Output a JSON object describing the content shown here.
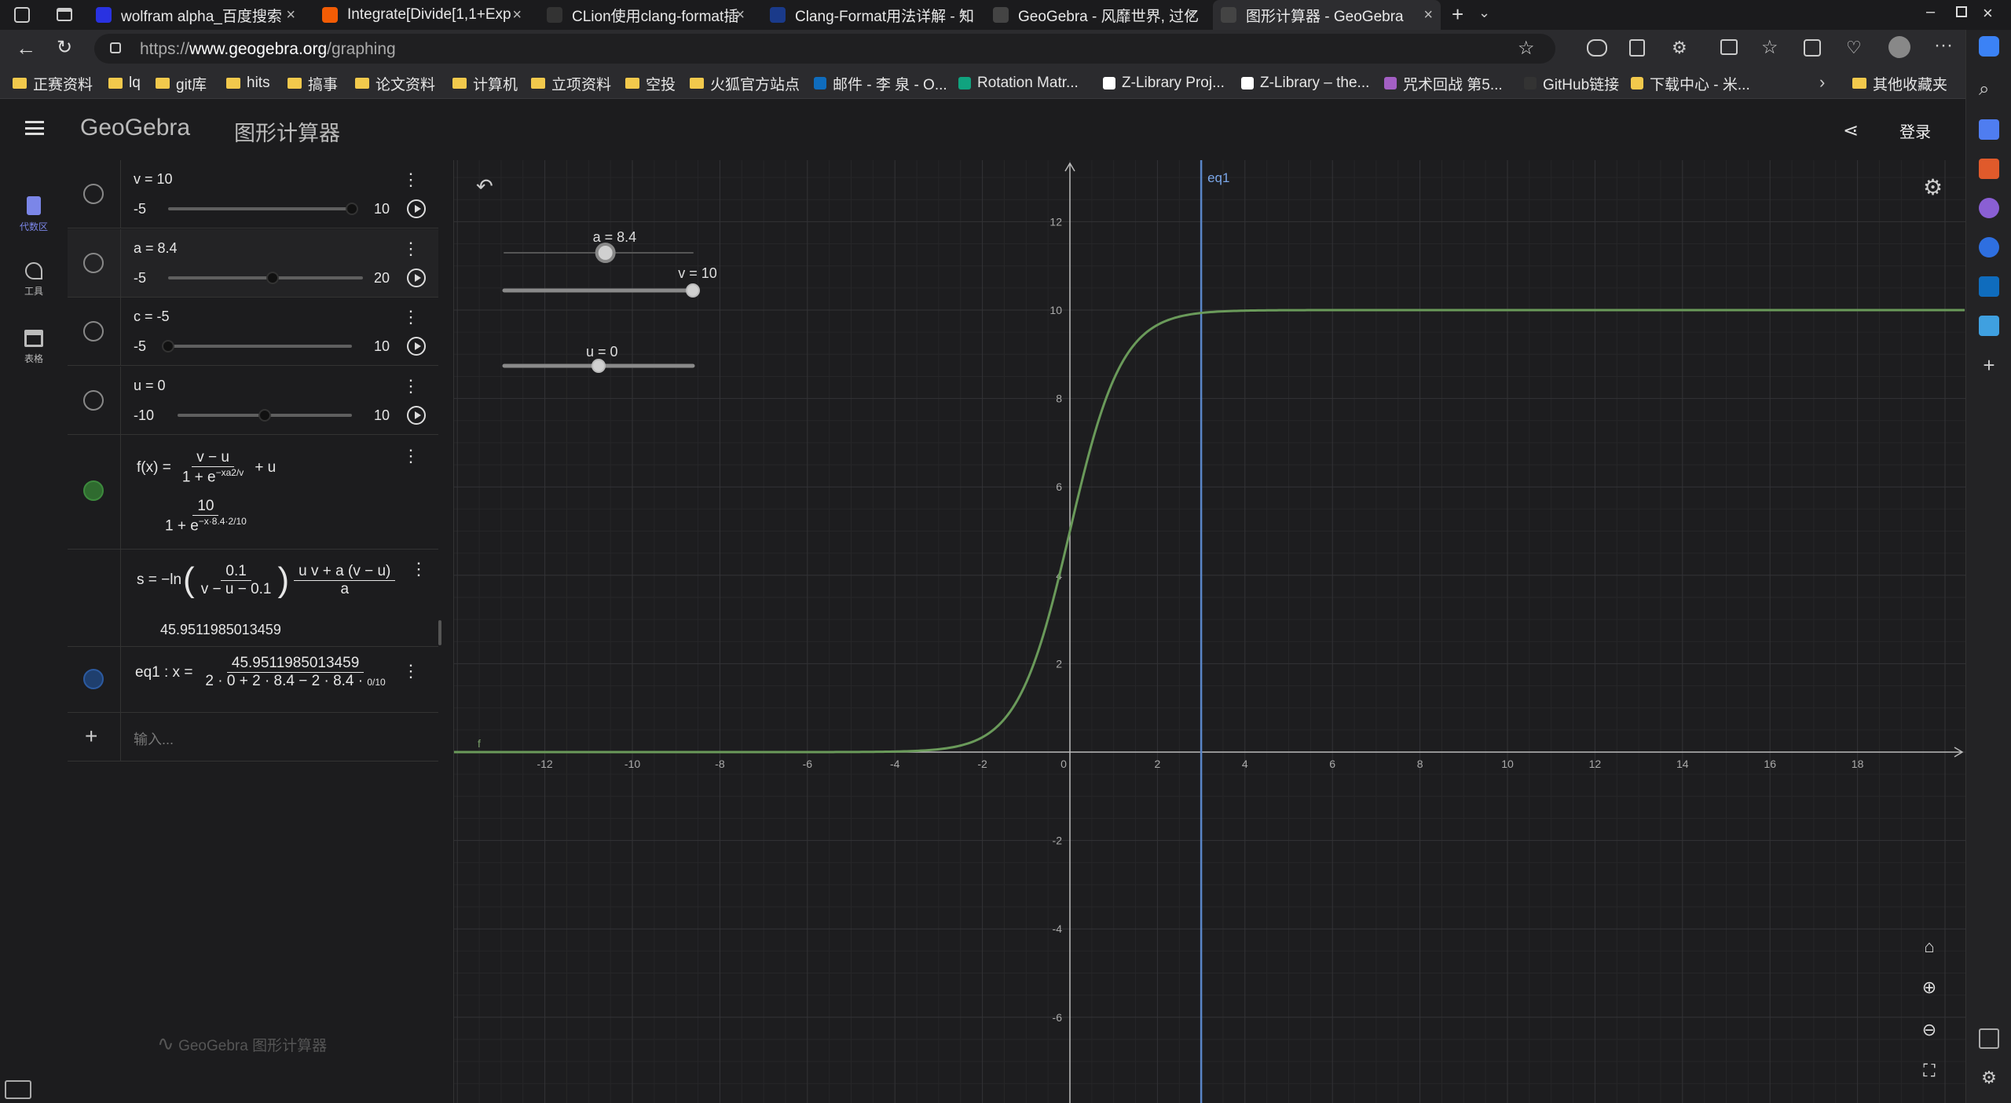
{
  "tabs": [
    {
      "title": "wolfram alpha_百度搜索",
      "icon": "baidu-icon",
      "color": "#2932e1"
    },
    {
      "title": "Integrate[Divide[1,1+Exp",
      "icon": "wolfram-icon",
      "color": "#f25c05"
    },
    {
      "title": "CLion使用clang-format插",
      "icon": "zhihu-icon",
      "color": "#333333"
    },
    {
      "title": "Clang-Format用法详解 - 知",
      "icon": "csdn-icon",
      "color": "#1a3a8a"
    },
    {
      "title": "GeoGebra - 风靡世界, 过亿",
      "icon": "geogebra-icon",
      "color": "#444444"
    },
    {
      "title": "图形计算器 - GeoGebra",
      "icon": "geogebra-graph-icon",
      "color": "#444444"
    }
  ],
  "address": {
    "prefix": "https://",
    "host": "www.geogebra.org",
    "path": "/graphing"
  },
  "bookmarks": [
    {
      "label": "正赛资料",
      "type": "folder"
    },
    {
      "label": "lq",
      "type": "folder"
    },
    {
      "label": "git库",
      "type": "folder"
    },
    {
      "label": "hits",
      "type": "folder"
    },
    {
      "label": "搞事",
      "type": "folder"
    },
    {
      "label": "论文资料",
      "type": "folder"
    },
    {
      "label": "计算机",
      "type": "folder"
    },
    {
      "label": "立项资料",
      "type": "folder"
    },
    {
      "label": "空投",
      "type": "folder"
    },
    {
      "label": "火狐官方站点",
      "type": "folder"
    },
    {
      "label": "邮件 - 李 泉 - O...",
      "type": "link",
      "color": "#0f6cbd"
    },
    {
      "label": "Rotation Matr...",
      "type": "link",
      "color": "#10a37f"
    },
    {
      "label": "Z-Library Proj...",
      "type": "link",
      "color": "#ffffff"
    },
    {
      "label": "Z-Library – the...",
      "type": "link",
      "color": "#ffffff"
    },
    {
      "label": "咒术回战 第5...",
      "type": "link",
      "color": "#a35fc4"
    },
    {
      "label": "GitHub链接",
      "type": "link",
      "color": "#333333"
    },
    {
      "label": "下载中心 - 米...",
      "type": "link",
      "color": "#f2c94c"
    }
  ],
  "bookmarks_other": "其他收藏夹",
  "app": {
    "logo": "GeoGebra",
    "title": "图形计算器",
    "login": "登录"
  },
  "nav": [
    {
      "label": "代数区",
      "icon": "calculator-icon",
      "active": true
    },
    {
      "label": "工具",
      "icon": "tools-icon",
      "active": false
    },
    {
      "label": "表格",
      "icon": "table-icon",
      "active": false
    }
  ],
  "algebra": {
    "sliders": [
      {
        "expr": "v = 10",
        "min": "-5",
        "max": "10",
        "minv": -5,
        "maxv": 10,
        "value": 10
      },
      {
        "expr": "a = 8.4",
        "min": "-5",
        "max": "20",
        "minv": -5,
        "maxv": 20,
        "value": 8.4
      },
      {
        "expr": "c = -5",
        "min": "-5",
        "max": "10",
        "minv": -5,
        "maxv": 10,
        "value": -5
      },
      {
        "expr": "u = 0",
        "min": "-10",
        "max": "10",
        "minv": -10,
        "maxv": 10,
        "value": 0
      }
    ],
    "f_lhs": "f(x) =",
    "f_num": "v − u",
    "f_den": "1 + e",
    "f_exp": "−xa",
    "f_exp_frac": "2/v",
    "f_plus": "+ u",
    "f_eval_num": "10",
    "f_eval_den": "1 + e",
    "f_eval_exp": "−x·8.4·",
    "f_eval_exp_frac": "2/10",
    "s_lhs": "s = −ln",
    "s_num": "0.1",
    "s_den": "v − u − 0.1",
    "s_rnum": "u v + a (v − u)",
    "s_rden": "a",
    "s_value": "45.9511985013459",
    "eq_lhs": "eq1 : x =",
    "eq_num": "45.9511985013459",
    "eq_den": "2 · 0 + 2 · 8.4 − 2 · 8.4 ·",
    "eq_den_frac": "0/10",
    "input_placeholder": "输入..."
  },
  "watermark": "GeoGebra 图形计算器",
  "graph": {
    "x_ticks": [
      "-12",
      "-10",
      "-8",
      "-6",
      "-4",
      "-2",
      "0",
      "2",
      "4",
      "6",
      "8",
      "10",
      "12",
      "14",
      "16",
      "18"
    ],
    "y_ticks": [
      "12",
      "10",
      "8",
      "6",
      "4",
      "2",
      "-2",
      "-4",
      "-6"
    ],
    "sliders": [
      {
        "label": "a = 8.4",
        "fraction": 0.536
      },
      {
        "label": "v = 10",
        "fraction": 1.0
      },
      {
        "label": "u = 0",
        "fraction": 0.5
      }
    ],
    "eq1_label": "eq1",
    "f_label": "f",
    "curve_color": "#6a9a5a",
    "eq_color": "#5a86c8"
  },
  "chart_data": {
    "type": "line",
    "title": "",
    "xlim": [
      -14,
      20
    ],
    "ylim": [
      -8,
      13
    ],
    "series": [
      {
        "name": "f",
        "formula": "10/(1+e^(-x*8.4*2/10))"
      },
      {
        "name": "eq1",
        "x_constant": 3.0
      }
    ]
  }
}
